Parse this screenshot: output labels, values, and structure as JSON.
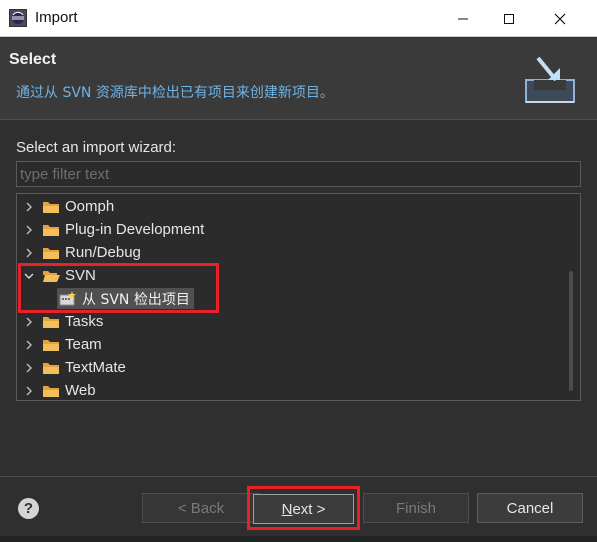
{
  "window": {
    "title": "Import",
    "icon": "eclipse-icon"
  },
  "header": {
    "title": "Select",
    "description": "通过从 SVN 资源库中检出已有项目来创建新项目。",
    "icon": "import-wizard-icon"
  },
  "wizard": {
    "label": "Select an import wizard:",
    "filter_placeholder": "type filter text",
    "filter_value": ""
  },
  "tree": {
    "items": [
      {
        "label": "Oomph",
        "expanded": false
      },
      {
        "label": "Plug-in Development",
        "expanded": false
      },
      {
        "label": "Run/Debug",
        "expanded": false
      },
      {
        "label": "SVN",
        "expanded": true
      },
      {
        "label": "Tasks",
        "expanded": false
      },
      {
        "label": "Team",
        "expanded": false
      },
      {
        "label": "TextMate",
        "expanded": false
      },
      {
        "label": "Web",
        "expanded": false
      }
    ],
    "svn_child": {
      "label": "从 SVN 检出项目",
      "selected": true
    }
  },
  "footer": {
    "help_label": "?",
    "back_label": "< Back",
    "next_mnemonic": "N",
    "next_rest": "ext >",
    "finish_label": "Finish",
    "cancel_label": "Cancel"
  },
  "colors": {
    "highlight": "#e8202a",
    "description": "#6fb3e6",
    "folder": "#e8a23a"
  }
}
